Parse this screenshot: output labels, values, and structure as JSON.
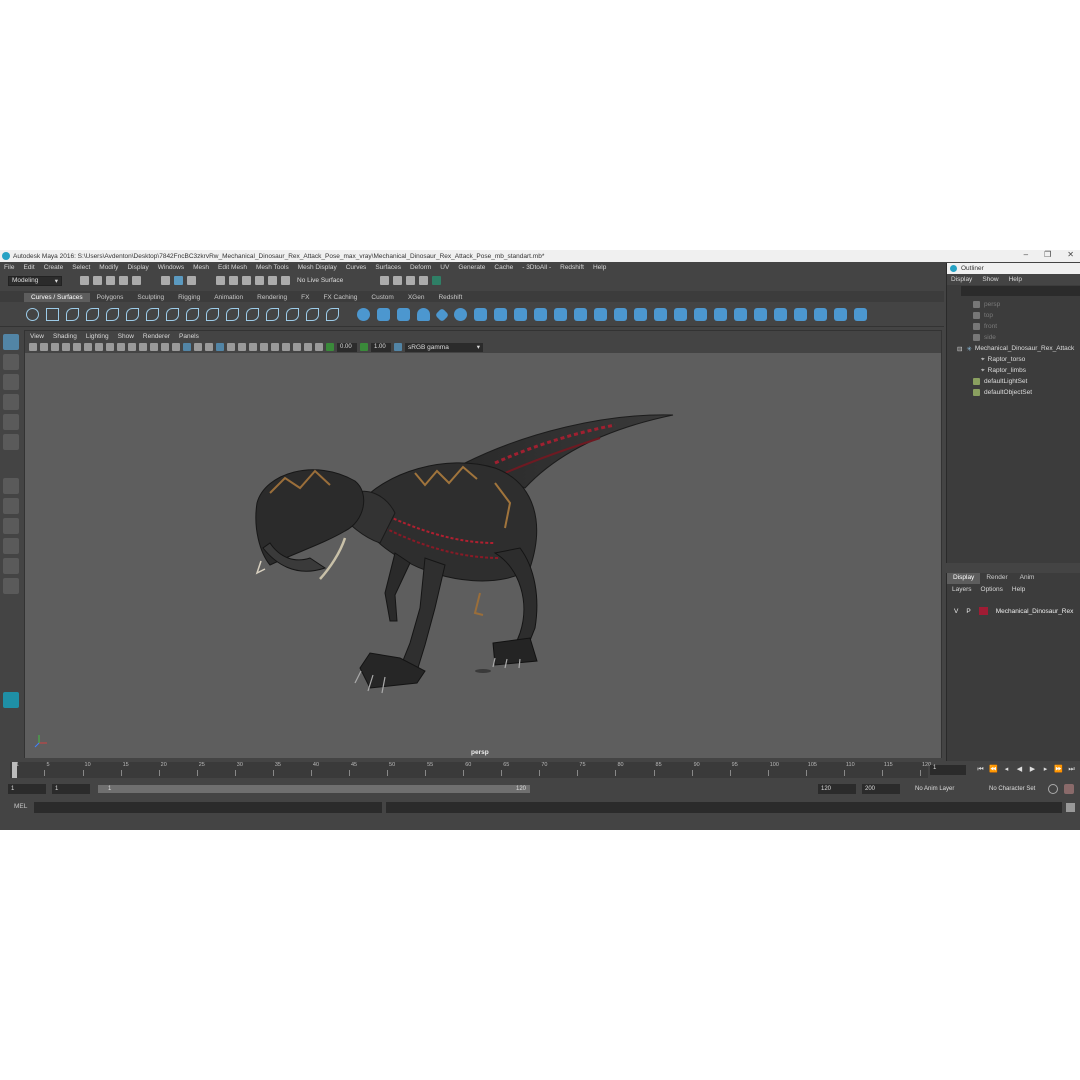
{
  "window": {
    "title": "Autodesk Maya 2016: S:\\Users\\Avdenton\\Desktop\\7842FncBC3zkrvRw_Mechanical_Dinosaur_Rex_Attack_Pose_max_vray\\Mechanical_Dinosaur_Rex_Attack_Pose_mb_standart.mb*",
    "controls": [
      "–",
      "❐",
      "✕"
    ]
  },
  "menubar": [
    "File",
    "Edit",
    "Create",
    "Select",
    "Modify",
    "Display",
    "Windows",
    "Mesh",
    "Edit Mesh",
    "Mesh Tools",
    "Mesh Display",
    "Curves",
    "Surfaces",
    "Deform",
    "UV",
    "Generate",
    "Cache",
    "- 3DtoAll -",
    "Redshift",
    "Help"
  ],
  "statusline": {
    "mode": "Modeling",
    "live_surface": "No Live Surface"
  },
  "shelf_tabs": [
    "Curves / Surfaces",
    "Polygons",
    "Sculpting",
    "Rigging",
    "Animation",
    "Rendering",
    "FX",
    "FX Caching",
    "Custom",
    "XGen",
    "Redshift"
  ],
  "shelf_active": "Curves / Surfaces",
  "panel": {
    "menu": [
      "View",
      "Shading",
      "Lighting",
      "Show",
      "Renderer",
      "Panels"
    ],
    "exposure": "0.00",
    "gamma": "1.00",
    "color_space": "sRGB gamma",
    "camera": "persp"
  },
  "outliner": {
    "title": "Outliner",
    "menu": [
      "Display",
      "Show",
      "Help"
    ],
    "items": [
      {
        "label": "persp",
        "dim": true
      },
      {
        "label": "top",
        "dim": true
      },
      {
        "label": "front",
        "dim": true
      },
      {
        "label": "side",
        "dim": true
      },
      {
        "label": "Mechanical_Dinosaur_Rex_Attack",
        "dim": false
      },
      {
        "label": "Raptor_torso",
        "dim": false
      },
      {
        "label": "Raptor_limbs",
        "dim": false
      },
      {
        "label": "defaultLightSet",
        "dim": false
      },
      {
        "label": "defaultObjectSet",
        "dim": false
      }
    ]
  },
  "layers": {
    "tabs": [
      "Display",
      "Render",
      "Anim"
    ],
    "menu": [
      "Layers",
      "Options",
      "Help"
    ],
    "row": {
      "v": "V",
      "p": "P",
      "name": "Mechanical_Dinosaur_Rex",
      "color": "#a01c34"
    }
  },
  "timeline": {
    "ticks": [
      "1",
      "5",
      "10",
      "15",
      "20",
      "25",
      "30",
      "35",
      "40",
      "45",
      "50",
      "55",
      "60",
      "65",
      "70",
      "75",
      "80",
      "85",
      "90",
      "95",
      "100",
      "105",
      "110",
      "115",
      "120"
    ],
    "current_frame": "1"
  },
  "range": {
    "start": "1",
    "anim_start": "1",
    "slider_start": "1",
    "slider_end": "120",
    "end": "120",
    "anim_end": "200",
    "anim_layer": "No Anim Layer",
    "character_set": "No Character Set"
  },
  "cmdline": {
    "label": "MEL"
  },
  "colors": {
    "accent": "#5285a6",
    "viewport_bg": "#5e5e5e",
    "ui_bg": "#444444"
  }
}
